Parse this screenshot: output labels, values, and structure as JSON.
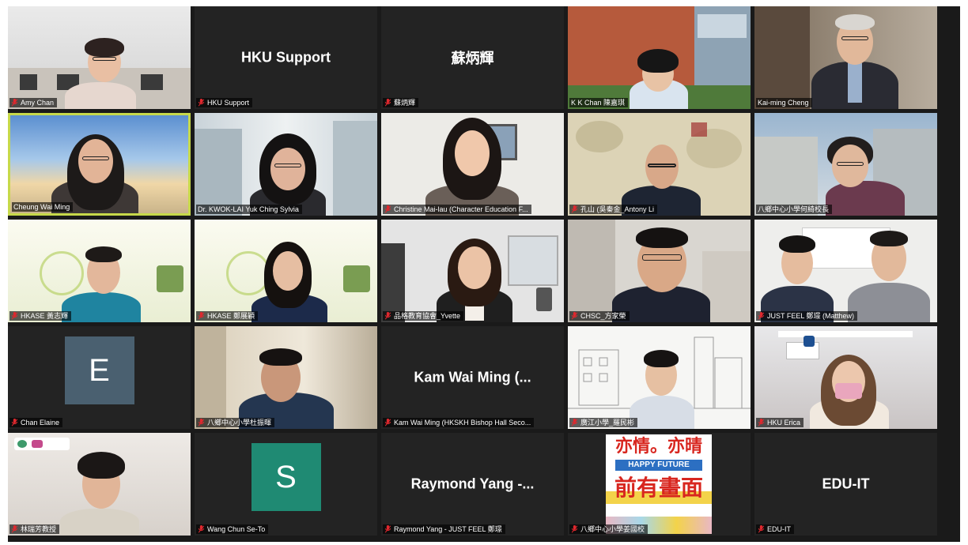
{
  "meeting": {
    "participants": [
      {
        "name": "Amy Chan",
        "big_name": "",
        "avatar_letter": "",
        "avatar_color": "",
        "muted": true,
        "video": true,
        "active": false
      },
      {
        "name": "HKU Support",
        "big_name": "HKU Support",
        "avatar_letter": "",
        "avatar_color": "",
        "muted": true,
        "video": false,
        "active": false
      },
      {
        "name": "蘇炳輝",
        "big_name": "蘇炳輝",
        "avatar_letter": "",
        "avatar_color": "",
        "muted": true,
        "video": false,
        "active": false
      },
      {
        "name": "K K Chan 陳嘉琪",
        "big_name": "",
        "avatar_letter": "",
        "avatar_color": "",
        "muted": false,
        "video": true,
        "active": false
      },
      {
        "name": "Kai-ming Cheng",
        "big_name": "",
        "avatar_letter": "",
        "avatar_color": "",
        "muted": false,
        "video": true,
        "active": false
      },
      {
        "name": "Cheung Wai Ming",
        "big_name": "",
        "avatar_letter": "",
        "avatar_color": "",
        "muted": false,
        "video": true,
        "active": true
      },
      {
        "name": "Dr. KWOK-LAI Yuk Ching Sylvia",
        "big_name": "",
        "avatar_letter": "",
        "avatar_color": "",
        "muted": true,
        "video": true,
        "active": false
      },
      {
        "name": "Christine Mai-lau (Character Education F...",
        "big_name": "",
        "avatar_letter": "",
        "avatar_color": "",
        "muted": true,
        "video": true,
        "active": false
      },
      {
        "name": "孔山 (吳秦金_Antony Li",
        "big_name": "",
        "avatar_letter": "",
        "avatar_color": "",
        "muted": true,
        "video": true,
        "active": false
      },
      {
        "name": "八鄉中心小學何綺校長",
        "big_name": "",
        "avatar_letter": "",
        "avatar_color": "",
        "muted": false,
        "video": true,
        "active": false
      },
      {
        "name": "HKASE 黃志輝",
        "big_name": "",
        "avatar_letter": "",
        "avatar_color": "",
        "muted": true,
        "video": true,
        "active": false
      },
      {
        "name": "HKASE 鄭展穎",
        "big_name": "",
        "avatar_letter": "",
        "avatar_color": "",
        "muted": true,
        "video": true,
        "active": false
      },
      {
        "name": "品格教育協會_Yvette",
        "big_name": "",
        "avatar_letter": "",
        "avatar_color": "",
        "muted": true,
        "video": true,
        "active": false
      },
      {
        "name": "CHSC_方家榮",
        "big_name": "",
        "avatar_letter": "",
        "avatar_color": "",
        "muted": true,
        "video": true,
        "active": false
      },
      {
        "name": "JUST FEEL 鄭璟 (Matthew)",
        "big_name": "",
        "avatar_letter": "",
        "avatar_color": "",
        "muted": true,
        "video": true,
        "active": false
      },
      {
        "name": "Chan Elaine",
        "big_name": "",
        "avatar_letter": "E",
        "avatar_color": "#4a6070",
        "muted": true,
        "video": false,
        "active": false
      },
      {
        "name": "八鄉中心小學杜振暉",
        "big_name": "",
        "avatar_letter": "",
        "avatar_color": "",
        "muted": true,
        "video": true,
        "active": false
      },
      {
        "name": "Kam Wai Ming (HKSKH Bishop Hall Seco...",
        "big_name": "Kam Wai Ming (...",
        "avatar_letter": "",
        "avatar_color": "",
        "muted": true,
        "video": false,
        "active": false
      },
      {
        "name": "廣江小學_羅民彬",
        "big_name": "",
        "avatar_letter": "",
        "avatar_color": "",
        "muted": true,
        "video": true,
        "active": false
      },
      {
        "name": "HKU Erica",
        "big_name": "",
        "avatar_letter": "",
        "avatar_color": "",
        "muted": true,
        "video": true,
        "active": false
      },
      {
        "name": "林瑞芳教授",
        "big_name": "",
        "avatar_letter": "",
        "avatar_color": "",
        "muted": true,
        "video": true,
        "active": false
      },
      {
        "name": "Wang Chun Se-To",
        "big_name": "",
        "avatar_letter": "S",
        "avatar_color": "#1f8a73",
        "muted": true,
        "video": false,
        "active": false
      },
      {
        "name": "Raymond Yang - JUST FEEL 鄭璟",
        "big_name": "Raymond Yang -...",
        "avatar_letter": "",
        "avatar_color": "",
        "muted": true,
        "video": false,
        "active": false
      },
      {
        "name": "八鄉中心小學姜國校",
        "big_name": "",
        "avatar_letter": "",
        "avatar_color": "",
        "muted": true,
        "video": true,
        "active": false
      },
      {
        "name": "EDU-IT",
        "big_name": "EDU-IT",
        "avatar_letter": "",
        "avatar_color": "",
        "muted": true,
        "video": false,
        "active": false
      }
    ],
    "screen_share_sign": {
      "top_line": "亦情。亦晴",
      "middle_line": "HAPPY FUTURE",
      "bottom_line": "前有畫面"
    },
    "colors": {
      "tile_background": "#232323",
      "active_speaker_border": "#c7d94a",
      "muted_icon": "#e0282e"
    }
  }
}
